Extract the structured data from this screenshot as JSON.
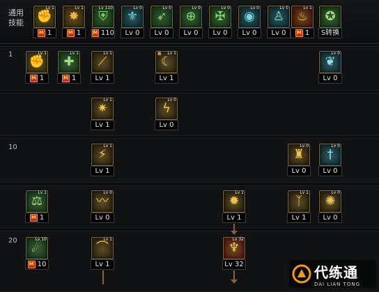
{
  "top_label": "通用\n技能",
  "top_skills": [
    {
      "icon": "arm-swing-icon",
      "mini": "Lv 1",
      "level": "1",
      "mastery": true
    },
    {
      "icon": "burst-icon",
      "mini": "Lv 1",
      "level": "1",
      "mastery": true
    },
    {
      "icon": "armor-icon",
      "mini": "Lv 110",
      "level": "110",
      "mastery": true
    },
    {
      "icon": "wings-icon",
      "mini": "Lv 0",
      "level": "Lv 0",
      "mastery": false
    },
    {
      "icon": "arrows-icon",
      "mini": "Lv 0",
      "level": "Lv 0",
      "mastery": false
    },
    {
      "icon": "crosshair-icon",
      "mini": "Lv 0",
      "level": "Lv 0",
      "mastery": false
    },
    {
      "icon": "rune-icon",
      "mini": "Lv 0",
      "level": "Lv 0",
      "mastery": false
    },
    {
      "icon": "eye-icon",
      "mini": "Lv 0",
      "level": "Lv 0",
      "mastery": false
    },
    {
      "icon": "body-icon",
      "mini": "Lv 0",
      "level": "Lv 0",
      "mastery": false
    },
    {
      "icon": "fire-icon",
      "mini": "Lv 1",
      "level": "1",
      "mastery": true
    },
    {
      "icon": "swap-icon",
      "mini": "",
      "level": "S转换",
      "mastery": false
    }
  ],
  "rows": [
    {
      "label": "1",
      "skills": [
        {
          "icon": "arm-swing-icon",
          "mini": "Lv 1",
          "level": "1",
          "mastery": true
        },
        {
          "icon": "cross-icon",
          "mini": "Lv 1",
          "level": "1",
          "mastery": true
        },
        {
          "icon": "slash-icon",
          "mini": "Lv 1",
          "level": "Lv 1"
        },
        {
          "icon": "lock-slash-icon",
          "mini": "Lv 1",
          "level": "Lv 1",
          "locked": true
        },
        {
          "icon": "feather-icon",
          "mini": "Lv 0",
          "level": "Lv 0"
        }
      ]
    },
    {
      "label": "",
      "skills": [
        {
          "icon": "spark-icon",
          "mini": "Lv 1",
          "level": "Lv 1"
        },
        {
          "icon": "bolt-icon",
          "mini": "Lv 0",
          "level": "Lv 0"
        }
      ]
    },
    {
      "label": "10",
      "skills": [
        {
          "icon": "strike-icon",
          "mini": "Lv 1",
          "level": "Lv 1"
        },
        {
          "icon": "cloak-icon",
          "mini": "Lv 0",
          "level": "Lv 0"
        },
        {
          "icon": "sword-icon",
          "mini": "Lv 0",
          "level": "Lv 0"
        }
      ]
    },
    {
      "label": "",
      "skills": [
        {
          "icon": "scale-icon",
          "mini": "Lv 1",
          "level": "1",
          "mastery": true
        },
        {
          "icon": "wing-slash-icon",
          "mini": "Lv 0",
          "level": "Lv 0"
        },
        {
          "icon": "explosion-icon",
          "mini": "Lv 1",
          "level": "Lv 1"
        },
        {
          "icon": "claw-icon",
          "mini": "Lv 1",
          "level": "Lv 1"
        },
        {
          "icon": "flame-burst-icon",
          "mini": "Lv 0",
          "level": "Lv 0"
        }
      ]
    },
    {
      "label": "20",
      "skills": [
        {
          "icon": "leg-icon",
          "mini": "Lv 10",
          "level": "10",
          "mastery": true
        },
        {
          "icon": "sweep-icon",
          "mini": "Lv 1",
          "level": "Lv 1"
        },
        {
          "icon": "demon-icon",
          "mini": "Lv 32",
          "level": "Lv 32"
        }
      ]
    }
  ],
  "watermark": {
    "main": "代练通",
    "sub": "DAI LIAN TONG"
  },
  "colors": {
    "gold": "#c8a53a",
    "green": "#3f8a3a",
    "teal": "#2a7e86",
    "red": "#b8321e"
  }
}
